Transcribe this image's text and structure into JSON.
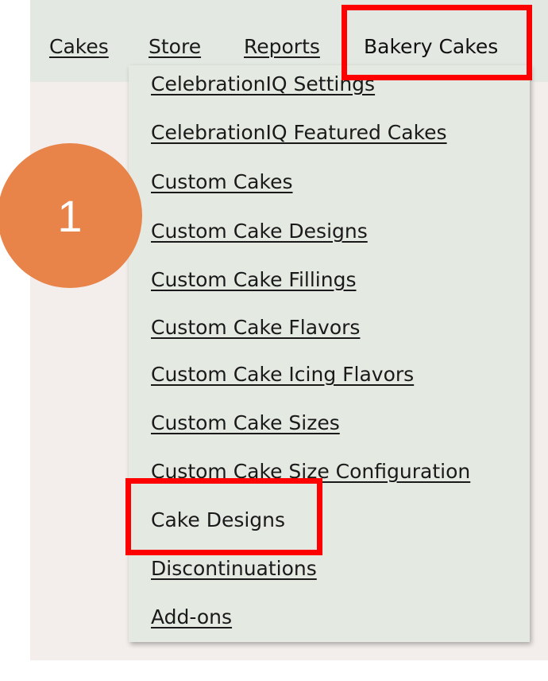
{
  "nav": {
    "items": [
      {
        "label": "Cakes"
      },
      {
        "label": "Store"
      },
      {
        "label": "Reports"
      },
      {
        "label": "Bakery Cakes"
      }
    ]
  },
  "dropdown": {
    "items": [
      {
        "label": "CelebrationIQ Settings"
      },
      {
        "label": "CelebrationIQ Featured Cakes"
      },
      {
        "label": "Custom Cakes"
      },
      {
        "label": "Custom Cake Designs"
      },
      {
        "label": "Custom Cake Fillings"
      },
      {
        "label": "Custom Cake Flavors"
      },
      {
        "label": "Custom Cake Icing Flavors"
      },
      {
        "label": "Custom Cake Sizes"
      },
      {
        "label": "Custom Cake Size Configuration"
      },
      {
        "label": "Cake Designs"
      },
      {
        "label": "Discontinuations"
      },
      {
        "label": "Add-ons"
      }
    ]
  },
  "annotation": {
    "step": "1",
    "step_color": "#e8834a",
    "highlight_color": "#ff0000",
    "highlighted": [
      "Bakery Cakes",
      "Cake Designs"
    ]
  }
}
